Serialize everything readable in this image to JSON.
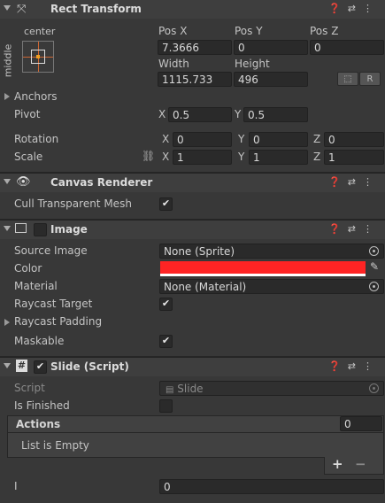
{
  "rect_transform": {
    "title": "Rect Transform",
    "anchor_h": "center",
    "anchor_v": "middle",
    "pos_x_label": "Pos X",
    "pos_y_label": "Pos Y",
    "pos_z_label": "Pos Z",
    "pos_x": "7.3666",
    "pos_y": "0",
    "pos_z": "0",
    "width_label": "Width",
    "height_label": "Height",
    "width": "1115.733",
    "height": "496",
    "r_button": "R",
    "anchors_label": "Anchors",
    "pivot_label": "Pivot",
    "pivot_x": "0.5",
    "pivot_y": "0.5",
    "rotation_label": "Rotation",
    "rot_x": "0",
    "rot_y": "0",
    "rot_z": "0",
    "scale_label": "Scale",
    "scale_x": "1",
    "scale_y": "1",
    "scale_z": "1",
    "x": "X",
    "y": "Y",
    "z": "Z"
  },
  "canvas_renderer": {
    "title": "Canvas Renderer",
    "cull_label": "Cull Transparent Mesh",
    "cull_checked": "✔"
  },
  "image": {
    "title": "Image",
    "source_label": "Source Image",
    "source_value": "None (Sprite)",
    "color_label": "Color",
    "color_value": "#ff2424",
    "material_label": "Material",
    "material_value": "None (Material)",
    "raycast_target_label": "Raycast Target",
    "raycast_target_checked": "✔",
    "raycast_padding_label": "Raycast Padding",
    "maskable_label": "Maskable",
    "maskable_checked": "✔"
  },
  "slide": {
    "title": "Slide (Script)",
    "enabled_checked": "✔",
    "script_label": "Script",
    "script_value": "Slide",
    "is_finished_label": "Is Finished",
    "actions_label": "Actions",
    "actions_count": "0",
    "list_empty": "List is Empty",
    "plus": "+",
    "minus": "−",
    "i_label": "I",
    "i_value": "0"
  },
  "icons": [
    "help-icon",
    "presets-icon",
    "kebab-menu-icon"
  ]
}
